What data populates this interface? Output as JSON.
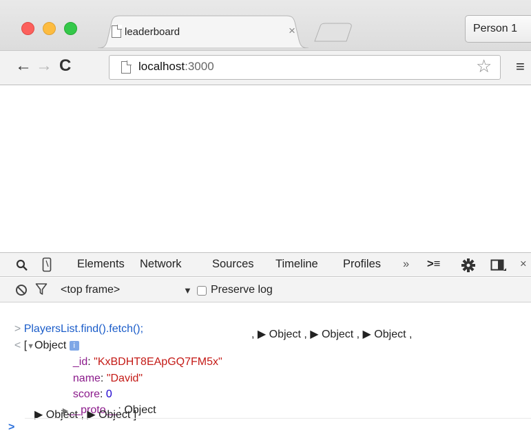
{
  "window": {
    "tab_title": "leaderboard",
    "tab_close": "×",
    "profile_button": "Person 1"
  },
  "toolbar": {
    "back": "←",
    "forward": "→",
    "reload": "C",
    "url_host": "localhost",
    "url_port": ":3000",
    "bookmark_star": "☆",
    "menu": "≡"
  },
  "devtools": {
    "tabs": [
      "Elements",
      "Network",
      "Sources",
      "Timeline",
      "Profiles"
    ],
    "more": "»",
    "drawer_icon": ">≡",
    "close": "×",
    "frame_select": "<top frame>",
    "frame_arrow": "▼",
    "preserve_log": "Preserve log",
    "console": {
      "input_prompt": ">",
      "command": "PlayersList.find().fetch();",
      "result_arrow": "<",
      "open_bracket": "[",
      "expanded_object": "Object",
      "info_badge": "i",
      "collapsed_objects": ", ▶ Object , ▶ Object , ▶ Object ,",
      "fields": [
        {
          "key": "_id",
          "value": "\"KxBDHT8EApGQ7FM5x\"",
          "type": "string"
        },
        {
          "key": "name",
          "value": "\"David\"",
          "type": "string"
        },
        {
          "key": "score",
          "value": "0",
          "type": "number"
        }
      ],
      "proto_key": "__proto__",
      "proto_value": ": Object",
      "trailing_objects": "▶ Object , ▶ Object ]",
      "caret": ">"
    }
  }
}
